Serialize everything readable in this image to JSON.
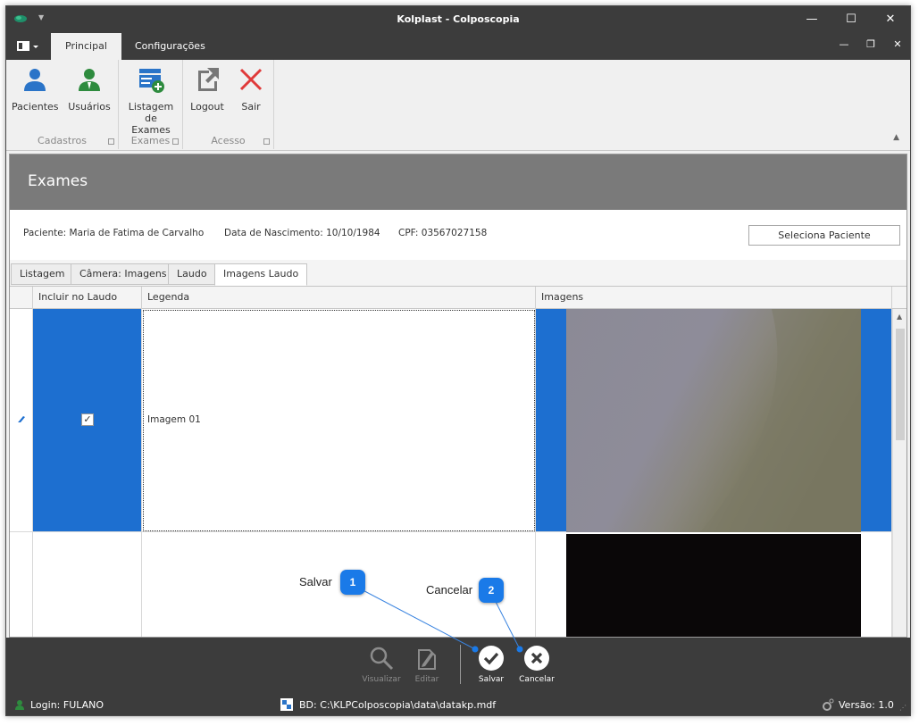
{
  "window": {
    "title": "Kolplast - Colposcopia"
  },
  "ribbon": {
    "tabs": [
      "Principal",
      "Configurações"
    ],
    "groups": [
      {
        "label": "Cadastros",
        "buttons": [
          "Pacientes",
          "Usuários"
        ]
      },
      {
        "label": "Exames",
        "buttons": [
          "Listagem de Exames"
        ]
      },
      {
        "label": "Acesso",
        "buttons": [
          "Logout",
          "Sair"
        ]
      }
    ]
  },
  "page": {
    "title": "Exames",
    "patient": "Paciente: Maria de Fatima de Carvalho",
    "birth": "Data de Nascimento: 10/10/1984",
    "cpf": "CPF: 03567027158",
    "select_patient": "Seleciona Paciente"
  },
  "tabs": [
    "Listagem",
    "Câmera: Imagens",
    "Laudo",
    "Imagens Laudo"
  ],
  "grid": {
    "columns": [
      "Incluir no Laudo",
      "Legenda",
      "Imagens"
    ],
    "rows": [
      {
        "included": true,
        "legend": "Imagem 01",
        "selected": true
      },
      {
        "included": false,
        "legend": "",
        "selected": false
      }
    ]
  },
  "toolbar": {
    "buttons": [
      {
        "label": "Visualizar",
        "enabled": false
      },
      {
        "label": "Editar",
        "enabled": false
      },
      {
        "label": "Salvar",
        "enabled": true
      },
      {
        "label": "Cancelar",
        "enabled": true
      }
    ]
  },
  "status": {
    "login": "Login: FULANO",
    "db": "BD: C:\\KLPColposcopia\\data\\datakp.mdf",
    "version": "Versão: 1.0"
  },
  "callouts": [
    {
      "number": "1",
      "label": "Salvar"
    },
    {
      "number": "2",
      "label": "Cancelar"
    }
  ],
  "colors": {
    "selection": "#1d6fd0",
    "chrome": "#3c3c3c",
    "header": "#7a7a7a",
    "accent_green": "#2e8b3e",
    "accent_blue": "#2a74c8",
    "exit_red": "#e03a3a"
  }
}
